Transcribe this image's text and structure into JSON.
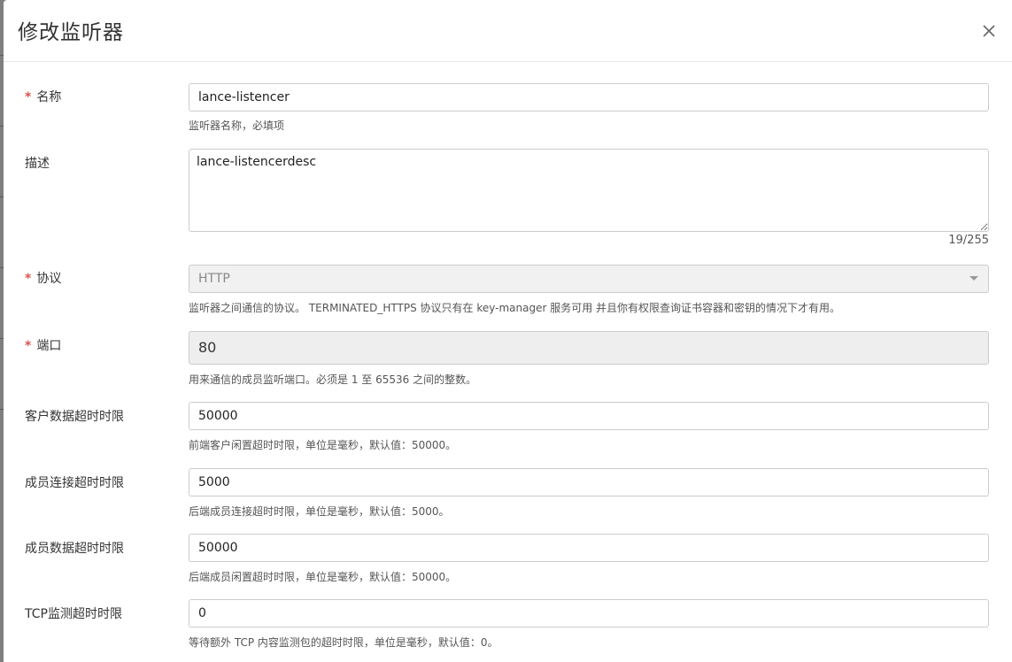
{
  "dialog": {
    "title": "修改监听器"
  },
  "fields": {
    "name": {
      "label": "名称",
      "required": "*",
      "value": "lance-listencer",
      "help": "监听器名称，必填项"
    },
    "description": {
      "label": "描述",
      "value": "lance-listencerdesc",
      "counter": "19/255"
    },
    "protocol": {
      "label": "协议",
      "required": "*",
      "selected": "HTTP",
      "help": "监听器之间通信的协议。 TERMINATED_HTTPS 协议只有在 key-manager 服务可用 并且你有权限查询证书容器和密钥的情况下才有用。"
    },
    "port": {
      "label": "端口",
      "required": "*",
      "value": "80",
      "help": "用来通信的成员监听端口。必须是 1 至 65536 之间的整数。"
    },
    "client_data_timeout": {
      "label": "客户数据超时时限",
      "value": "50000",
      "help": "前端客户闲置超时时限，单位是毫秒，默认值：50000。"
    },
    "member_connect_timeout": {
      "label": "成员连接超时时限",
      "value": "5000",
      "help": "后端成员连接超时时限，单位是毫秒，默认值：5000。"
    },
    "member_data_timeout": {
      "label": "成员数据超时时限",
      "value": "50000",
      "help": "后端成员闲置超时时限，单位是毫秒，默认值：50000。"
    },
    "tcp_inspect_timeout": {
      "label": "TCP监测超时时限",
      "value": "0",
      "help": "等待额外 TCP 内容监测包的超时时限，单位是毫秒，默认值：0。"
    }
  },
  "colors": {
    "required": "#d9534f",
    "border": "#cccccc",
    "readonly_bg": "#eeeeee"
  }
}
